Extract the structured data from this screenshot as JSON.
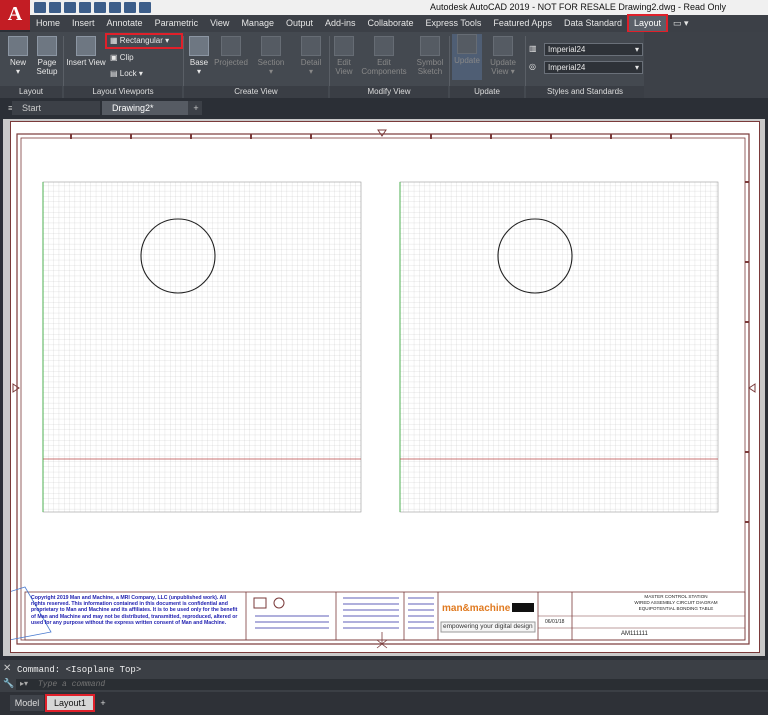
{
  "window": {
    "title": "Autodesk AutoCAD 2019 - NOT FOR RESALE    Drawing2.dwg - Read Only",
    "logo": "A"
  },
  "ribbon_tabs": [
    "Home",
    "Insert",
    "Annotate",
    "Parametric",
    "View",
    "Manage",
    "Output",
    "Add-ins",
    "Collaborate",
    "Express Tools",
    "Featured Apps",
    "Data Standard",
    "Layout"
  ],
  "ribbon": {
    "layout_panel": {
      "title": "Layout",
      "new": "New",
      "page_setup": "Page Setup"
    },
    "viewports_panel": {
      "title": "Layout Viewports",
      "insert_view": "Insert View",
      "rectangular": "Rectangular",
      "clip": "Clip",
      "lock": "Lock"
    },
    "create_view_panel": {
      "title": "Create View",
      "base": "Base",
      "projected": "Projected",
      "section": "Section",
      "detail": "Detail"
    },
    "modify_view_panel": {
      "title": "Modify View",
      "edit_view": "Edit View",
      "edit_components": "Edit Components",
      "symbol_sketch": "Symbol Sketch"
    },
    "update_panel": {
      "title": "Update",
      "update": "Update",
      "auto_update": "Update View"
    },
    "styles_panel": {
      "title": "Styles and Standards",
      "style1": "Imperial24",
      "style2": "Imperial24"
    }
  },
  "doc_tabs": {
    "start": "Start",
    "drawing": "Drawing2*"
  },
  "titleblock": {
    "disclaimer": "Copyright 2019 Man and Machine, a MRI Company, LLC (unpublished work). All rights reserved. This information contained in this document is confidential and proprietary to Man and Machine and its affiliates. It is to be used only for the benefit of Man and Machine and may not be distributed, transmitted, reproduced, altered or used for any purpose without the express written consent of Man and Machine.",
    "brand": "man&machine",
    "tagline": "empowering your digital design",
    "title_lines": [
      "MASTER CONTROL STATION",
      "WIRED ASSEMBLY CIRCUIT DIAGRAM",
      "EQUIPOTENTIAL BONDING TABLE"
    ],
    "drawing_no": "AM111111",
    "date": "06/01/18"
  },
  "command": {
    "history": "Command:  <Isoplane Top>",
    "placeholder": "Type a command"
  },
  "layout_tabs": {
    "model": "Model",
    "layout1": "Layout1",
    "add": "+"
  }
}
